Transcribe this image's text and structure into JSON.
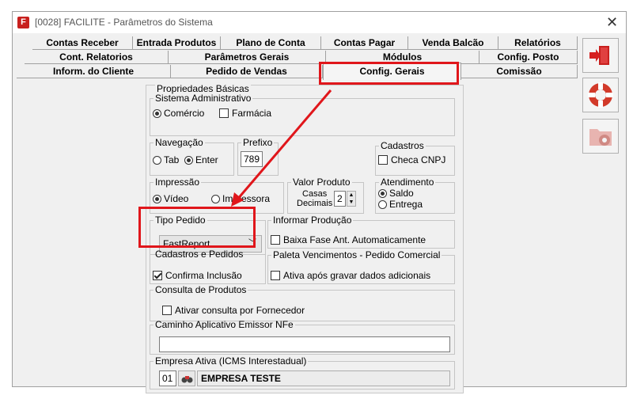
{
  "window": {
    "title": "[0028] FACILITE - Parâmetros do Sistema",
    "close_symbol": "✕"
  },
  "tabs": {
    "row1": [
      "Contas Receber",
      "Entrada Produtos",
      "Plano de Conta",
      "Contas Pagar",
      "Venda Balcão",
      "Relatórios"
    ],
    "row2": [
      "Cont. Relatorios",
      "Parâmetros Gerais",
      "Módulos",
      "Config. Posto"
    ],
    "row3": [
      "Inform. do Cliente",
      "Pedido de Vendas",
      "Config. Gerais",
      "Comissão"
    ],
    "active": "Config. Gerais"
  },
  "props": {
    "title": "Propriedades Básicas",
    "sistema": {
      "label": "Sistema Administrativo",
      "comercio": "Comércio",
      "farmacia": "Farmácia"
    },
    "navegacao": {
      "label": "Navegação",
      "tab": "Tab",
      "enter": "Enter"
    },
    "prefixo": {
      "label": "Prefixo",
      "value": "789"
    },
    "cadastros": {
      "label": "Cadastros",
      "checa_cnpj": "Checa CNPJ"
    },
    "impressao": {
      "label": "Impressão",
      "video": "Vídeo",
      "impressora": "Impressora"
    },
    "valor_produto": {
      "label": "Valor Produto",
      "casas": "Casas",
      "decimais": "Decimais",
      "value": "2"
    },
    "atendimento": {
      "label": "Atendimento",
      "saldo": "Saldo",
      "entrega": "Entrega"
    },
    "tipo_pedido": {
      "label": "Tipo Pedido",
      "value": "FastReport"
    },
    "informar_producao": {
      "label": "Informar Produção",
      "baixa": "Baixa Fase Ant. Automaticamente"
    },
    "cad_pedidos": {
      "label": "Cadastros e Pedidos",
      "confirma": "Confirma Inclusão"
    },
    "paleta": {
      "label": "Paleta Vencimentos - Pedido Comercial",
      "ativa": "Ativa após gravar dados adicionais"
    },
    "consulta": {
      "label": "Consulta de Produtos",
      "ativar": "Ativar consulta por Fornecedor"
    },
    "caminho": {
      "label": "Caminho Aplicativo Emissor NFe",
      "value": ""
    },
    "empresa": {
      "label": "Empresa Ativa (ICMS Interestadual)",
      "code": "01",
      "name": "EMPRESA TESTE"
    }
  },
  "icons": {
    "exit": "exit-door-icon",
    "help": "lifebuoy-icon",
    "config": "folder-gear-icon"
  },
  "colors": {
    "highlight": "#e0161b",
    "app_icon": "#c8201e"
  }
}
